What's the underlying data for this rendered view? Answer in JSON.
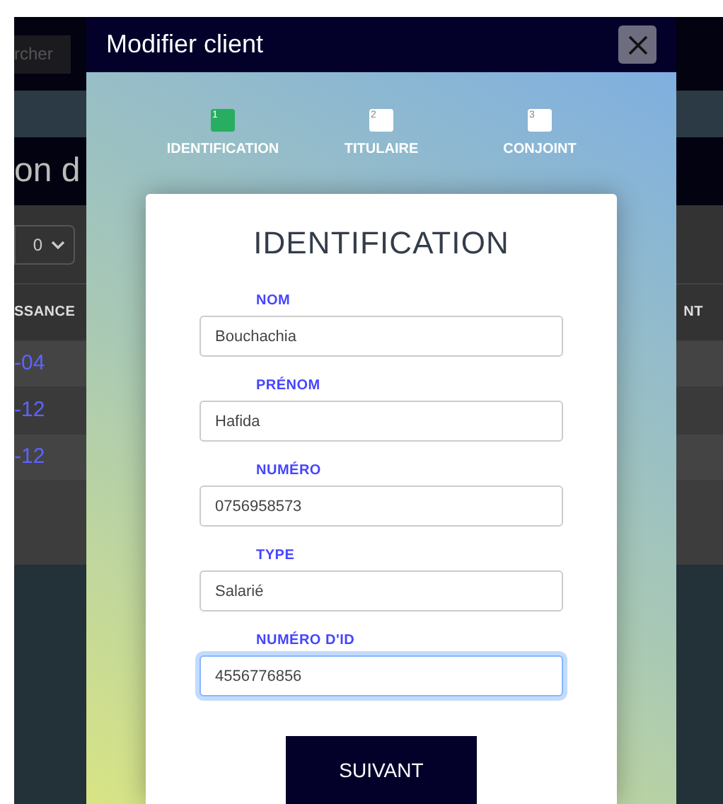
{
  "backdrop": {
    "search": {
      "placeholder": "rcher"
    },
    "heading": "on d",
    "page_size": "0",
    "columns": [
      "SSANCE",
      "NT"
    ],
    "rows": [
      "-04",
      "-12",
      "-12"
    ]
  },
  "modal": {
    "title": "Modifier client",
    "steps": [
      {
        "number": "1",
        "label": "IDENTIFICATION",
        "selected": true
      },
      {
        "number": "2",
        "label": "TITULAIRE",
        "selected": false
      },
      {
        "number": "3",
        "label": "CONJOINT",
        "selected": false
      }
    ],
    "card_title": "IDENTIFICATION",
    "fields": [
      {
        "label": "NOM",
        "value": "Bouchachia",
        "focused": false
      },
      {
        "label": "PRÉNOM",
        "value": "Hafida",
        "focused": false
      },
      {
        "label": "NUMÉRO",
        "value": "0756958573",
        "focused": false
      },
      {
        "label": "TYPE",
        "value": "Salarié",
        "focused": false
      },
      {
        "label": "NUMÉRO D'ID",
        "value": "4556776856",
        "focused": true
      }
    ],
    "button": "SUIVANT"
  }
}
